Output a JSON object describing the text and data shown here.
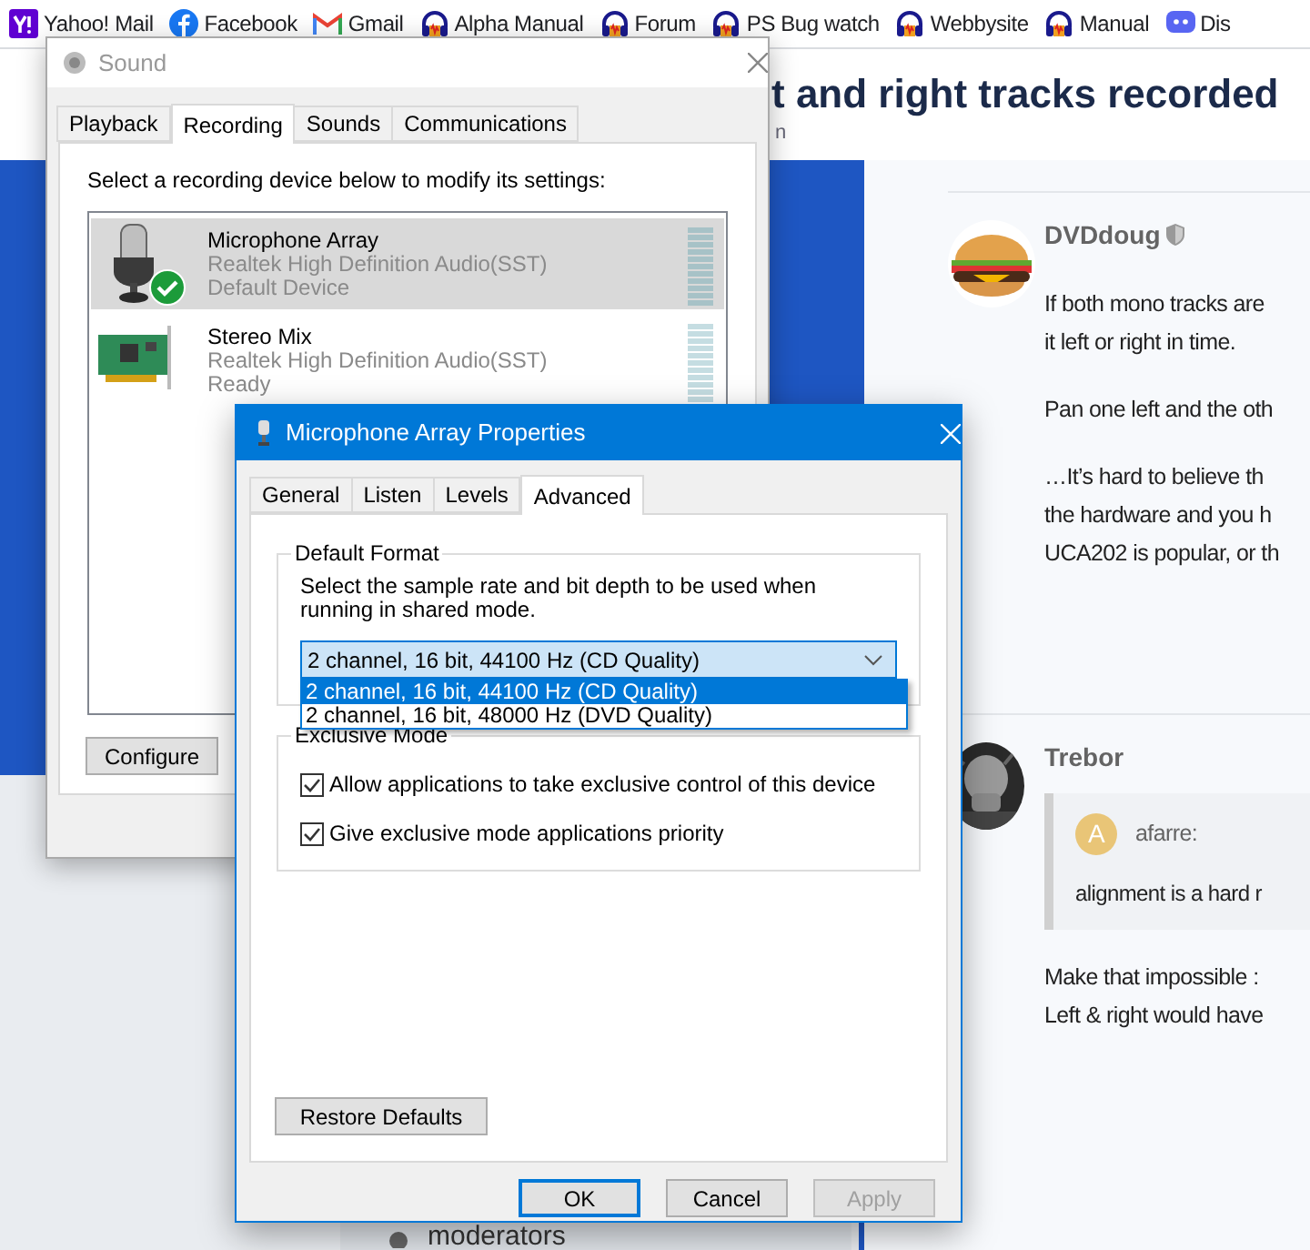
{
  "bookmarks": [
    {
      "label": "Yahoo! Mail",
      "kind": "yahoo"
    },
    {
      "label": "Facebook",
      "kind": "facebook"
    },
    {
      "label": "Gmail",
      "kind": "gmail"
    },
    {
      "label": "Alpha Manual",
      "kind": "headphones"
    },
    {
      "label": "Forum",
      "kind": "headphones"
    },
    {
      "label": "PS Bug watch",
      "kind": "headphones"
    },
    {
      "label": "Webbysite",
      "kind": "headphones"
    },
    {
      "label": "Manual",
      "kind": "headphones"
    },
    {
      "label": "Dis",
      "kind": "chat"
    }
  ],
  "page": {
    "title": "t and right tracks recorded",
    "subtitle": "n",
    "sidebar_item": "moderators",
    "posts": [
      {
        "author": "DVDdoug",
        "moderator": true,
        "paragraphs": [
          [
            "If both mono tracks are",
            "it left or right in time."
          ],
          [
            "Pan one left and the oth"
          ],
          [
            "…It’s hard to believe th",
            "the hardware and you h",
            "UCA202 is popular, or th"
          ]
        ]
      },
      {
        "author": "Trebor",
        "moderator": false,
        "quote": {
          "initial": "A",
          "author": "afarre:",
          "text": "alignment is a hard r"
        },
        "paragraphs": [
          [
            "Make that impossible :",
            "Left & right would have"
          ]
        ]
      }
    ]
  },
  "sound_window": {
    "title": "Sound",
    "active": false,
    "tabs": [
      {
        "label": "Playback",
        "selected": false
      },
      {
        "label": "Recording",
        "selected": true
      },
      {
        "label": "Sounds",
        "selected": false
      },
      {
        "label": "Communications",
        "selected": false
      }
    ],
    "instruction": "Select a recording device below to modify its settings:",
    "devices": [
      {
        "kind": "microphone",
        "name": "Microphone Array",
        "driver": "Realtek High Definition Audio(SST)",
        "status": "Default Device",
        "default": true,
        "selected": true
      },
      {
        "kind": "sound-card",
        "name": "Stereo Mix",
        "driver": "Realtek High Definition Audio(SST)",
        "status": "Ready",
        "default": false,
        "selected": false
      }
    ],
    "buttons": [
      "Configure"
    ]
  },
  "properties_dialog": {
    "title": "Microphone Array Properties",
    "active": true,
    "tabs": [
      {
        "label": "General",
        "selected": false
      },
      {
        "label": "Listen",
        "selected": false
      },
      {
        "label": "Levels",
        "selected": false
      },
      {
        "label": "Advanced",
        "selected": true
      }
    ],
    "default_format": {
      "heading": "Default Format",
      "description": "Select the sample rate and bit depth to be used when running in shared mode.",
      "value": "2 channel, 16 bit, 44100 Hz (CD Quality)",
      "expanded": true,
      "options": [
        {
          "label": "2 channel, 16 bit, 44100 Hz (CD Quality)",
          "selected": true
        },
        {
          "label": "2 channel, 16 bit, 48000 Hz (DVD Quality)",
          "selected": false
        }
      ]
    },
    "exclusive_mode": {
      "heading": "Exclusive Mode",
      "options": [
        {
          "label": "Allow applications to take exclusive control of this device",
          "checked": true
        },
        {
          "label": "Give exclusive mode applications priority",
          "checked": true
        }
      ]
    },
    "restore_button": "Restore Defaults",
    "buttons": [
      {
        "label": "OK",
        "default": true,
        "disabled": false
      },
      {
        "label": "Cancel",
        "default": false,
        "disabled": false
      },
      {
        "label": "Apply",
        "default": false,
        "disabled": true
      }
    ]
  }
}
